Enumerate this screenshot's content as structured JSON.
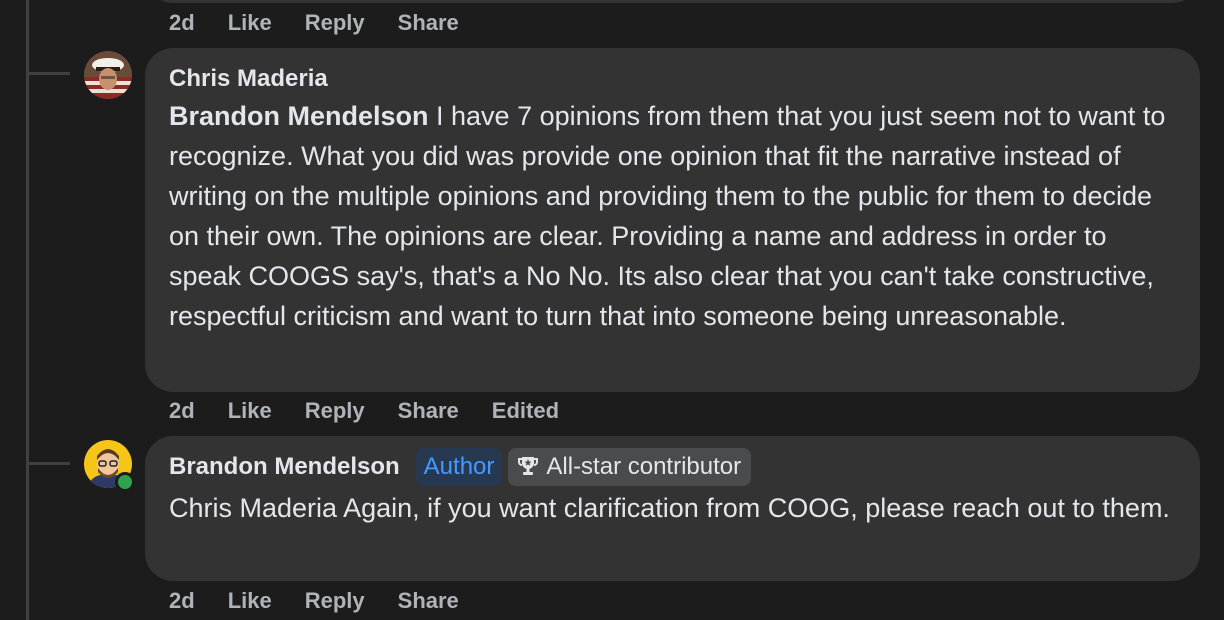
{
  "top_actions": {
    "time": "2d",
    "like": "Like",
    "reply": "Reply",
    "share": "Share"
  },
  "comment1": {
    "author": "Chris Maderia",
    "mention": "Brandon Mendelson",
    "text": " I have 7 opinions from them that you just seem not to want to recognize. What you did was provide one opinion that fit the narrative instead of writing on the multiple opinions and providing them to the public for them to decide on their own. The opinions are clear. Providing a name and address in order to speak COOGS say's, that's a No No. Its also clear that you can't take constructive, respectful criticism and want to turn that into someone being unreasonable.",
    "actions": {
      "time": "2d",
      "like": "Like",
      "reply": "Reply",
      "share": "Share",
      "edited": "Edited"
    }
  },
  "comment2": {
    "author": "Brandon Mendelson",
    "badge_author": "Author",
    "badge_allstar": "All-star contributor",
    "text": "Chris Maderia Again, if you want clarification from COOG, please reach out to them.",
    "actions": {
      "time": "2d",
      "like": "Like",
      "reply": "Reply",
      "share": "Share"
    }
  },
  "colors": {
    "background": "#1c1c1d",
    "bubble": "#333334",
    "action_text": "#b0b3b8",
    "author_badge_text": "#4599ff",
    "online": "#31a24c"
  }
}
